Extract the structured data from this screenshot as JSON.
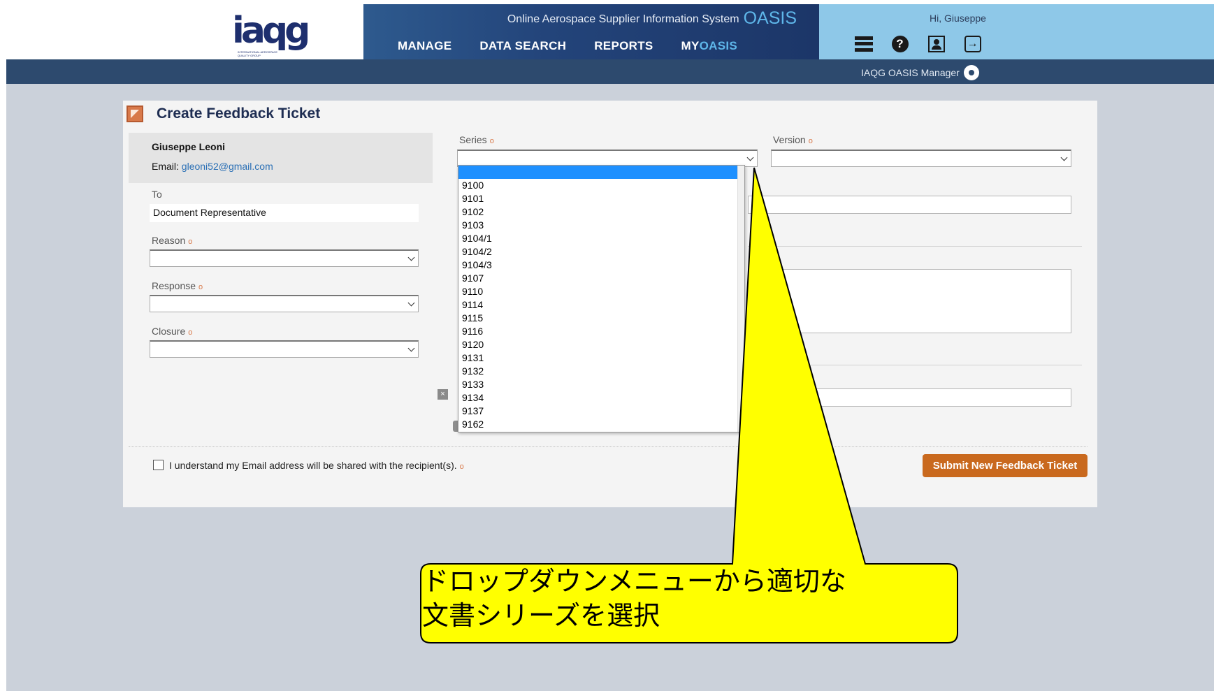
{
  "header": {
    "system_title": "Online Aerospace Supplier Information System",
    "system_name": "OASIS",
    "logo_text": "iaqg",
    "logo_subtext": "INTERNATIONAL AEROSPACE QUALITY GROUP",
    "greeting": "Hi, Giuseppe",
    "nav": {
      "manage": "MANAGE",
      "data_search": "DATA SEARCH",
      "reports": "REPORTS",
      "my_prefix": "MY",
      "my_suffix": "OASIS"
    },
    "role": "IAQG OASIS Manager",
    "icons": [
      "menu-icon",
      "help-icon",
      "profile-icon",
      "logout-icon",
      "gear-icon"
    ]
  },
  "form": {
    "title": "Create Feedback Ticket",
    "user_name": "Giuseppe Leoni",
    "email_label": "Email:",
    "email": "gleoni52@gmail.com",
    "to_label": "To",
    "to_value": "Document Representative",
    "reason_label": "Reason",
    "response_label": "Response",
    "closure_label": "Closure",
    "series_label": "Series",
    "version_label": "Version",
    "required_marker": "o",
    "agree_text": "I understand my Email address will be shared with the recipient(s).",
    "submit_label": "Submit New Feedback Ticket",
    "remove_icon_glyph": "×"
  },
  "series_dropdown": {
    "selected": "",
    "options": [
      "9100",
      "9101",
      "9102",
      "9103",
      "9104/1",
      "9104/2",
      "9104/3",
      "9107",
      "9110",
      "9114",
      "9115",
      "9116",
      "9120",
      "9131",
      "9132",
      "9133",
      "9134",
      "9137",
      "9162"
    ]
  },
  "callout": {
    "line1": "ドロップダウンメニューから適切な",
    "line2": "文書シリーズを選択",
    "fill_color": "#ffff00"
  },
  "colors": {
    "accent": "#c9691e",
    "nav_dark": "#23447a",
    "nav_light": "#8ec8e8",
    "oasis_blue": "#5fb7ea"
  }
}
